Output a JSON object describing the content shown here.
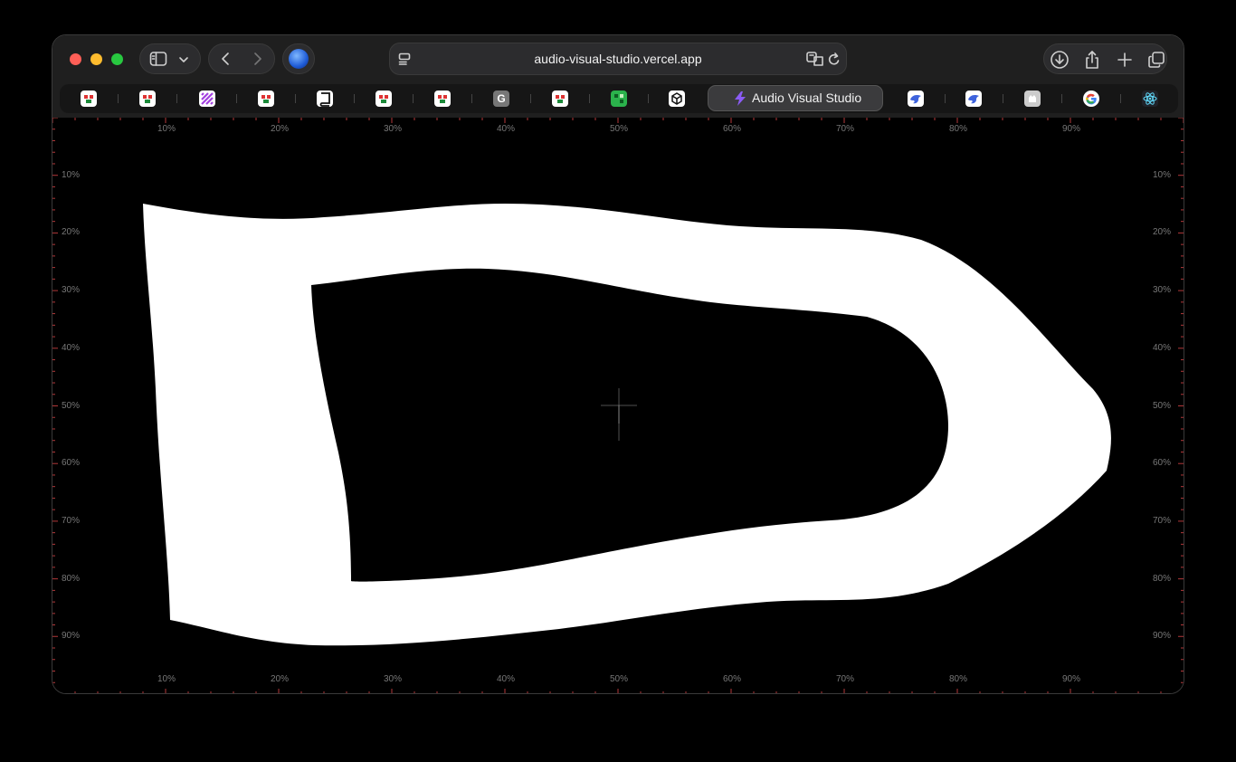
{
  "browser": {
    "url": "audio-visual-studio.vercel.app",
    "active_tab_label": "Audio Visual Studio",
    "tabs": [
      {
        "icon": "red-green-favicon-icon",
        "color": "#d33"
      },
      {
        "icon": "red-green-favicon-icon",
        "color": "#d33"
      },
      {
        "icon": "purple-stripes-favicon-icon",
        "color": "#a340e0"
      },
      {
        "icon": "red-green-favicon-icon",
        "color": "#d33"
      },
      {
        "icon": "book-favicon-icon",
        "color": "#ffffff"
      },
      {
        "icon": "red-green-favicon-icon",
        "color": "#d33"
      },
      {
        "icon": "red-green-favicon-icon",
        "color": "#d33"
      },
      {
        "icon": "g-letter-favicon-icon",
        "color": "#777"
      },
      {
        "icon": "red-green-favicon-icon",
        "color": "#d33"
      },
      {
        "icon": "green-pixel-favicon-icon",
        "color": "#2bb24c"
      },
      {
        "icon": "cube-favicon-icon",
        "color": "#ffffff"
      },
      {
        "icon": "bird-favicon-icon",
        "color": "#3e63dd"
      },
      {
        "icon": "bird-favicon-icon",
        "color": "#3e63dd"
      },
      {
        "icon": "github-favicon-icon",
        "color": "#cccccc"
      },
      {
        "icon": "google-favicon-icon",
        "color": "#4285f4"
      },
      {
        "icon": "react-favicon-icon",
        "color": "#61dafb"
      }
    ],
    "g_letter": "G"
  },
  "canvas": {
    "ruler_labels": [
      "10%",
      "20%",
      "30%",
      "40%",
      "50%",
      "60%",
      "70%",
      "80%",
      "90%"
    ],
    "ruler_color": "#b3383a",
    "shape_fill": "#ffffff"
  }
}
